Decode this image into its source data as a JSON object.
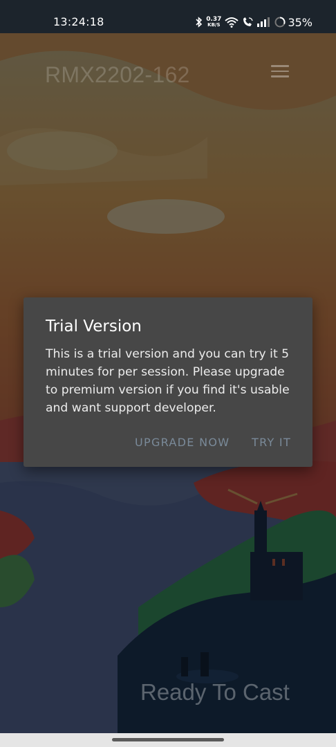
{
  "status_bar": {
    "time": "13:24:18",
    "speed_value": "0.37",
    "speed_unit": "KB/S",
    "battery": "35%",
    "icons": [
      "bluetooth-icon",
      "wifi-icon",
      "wifi-calling-icon",
      "signal-icon",
      "battery-icon"
    ]
  },
  "app": {
    "title": "RMX2202-162",
    "status": "Ready To Cast",
    "menu_icon": "hamburger-menu-icon"
  },
  "dialog": {
    "title": "Trial Version",
    "message": "This is a trial version and you can try it 5 minutes for per session. Please upgrade to premium version if you find it's usable and want support developer.",
    "buttons": {
      "upgrade": "UPGRADE NOW",
      "try": "TRY IT"
    }
  },
  "colors": {
    "dialog_bg": "#474747",
    "button_text": "#7a8a99",
    "status_bar_bg": "#1c242c"
  }
}
